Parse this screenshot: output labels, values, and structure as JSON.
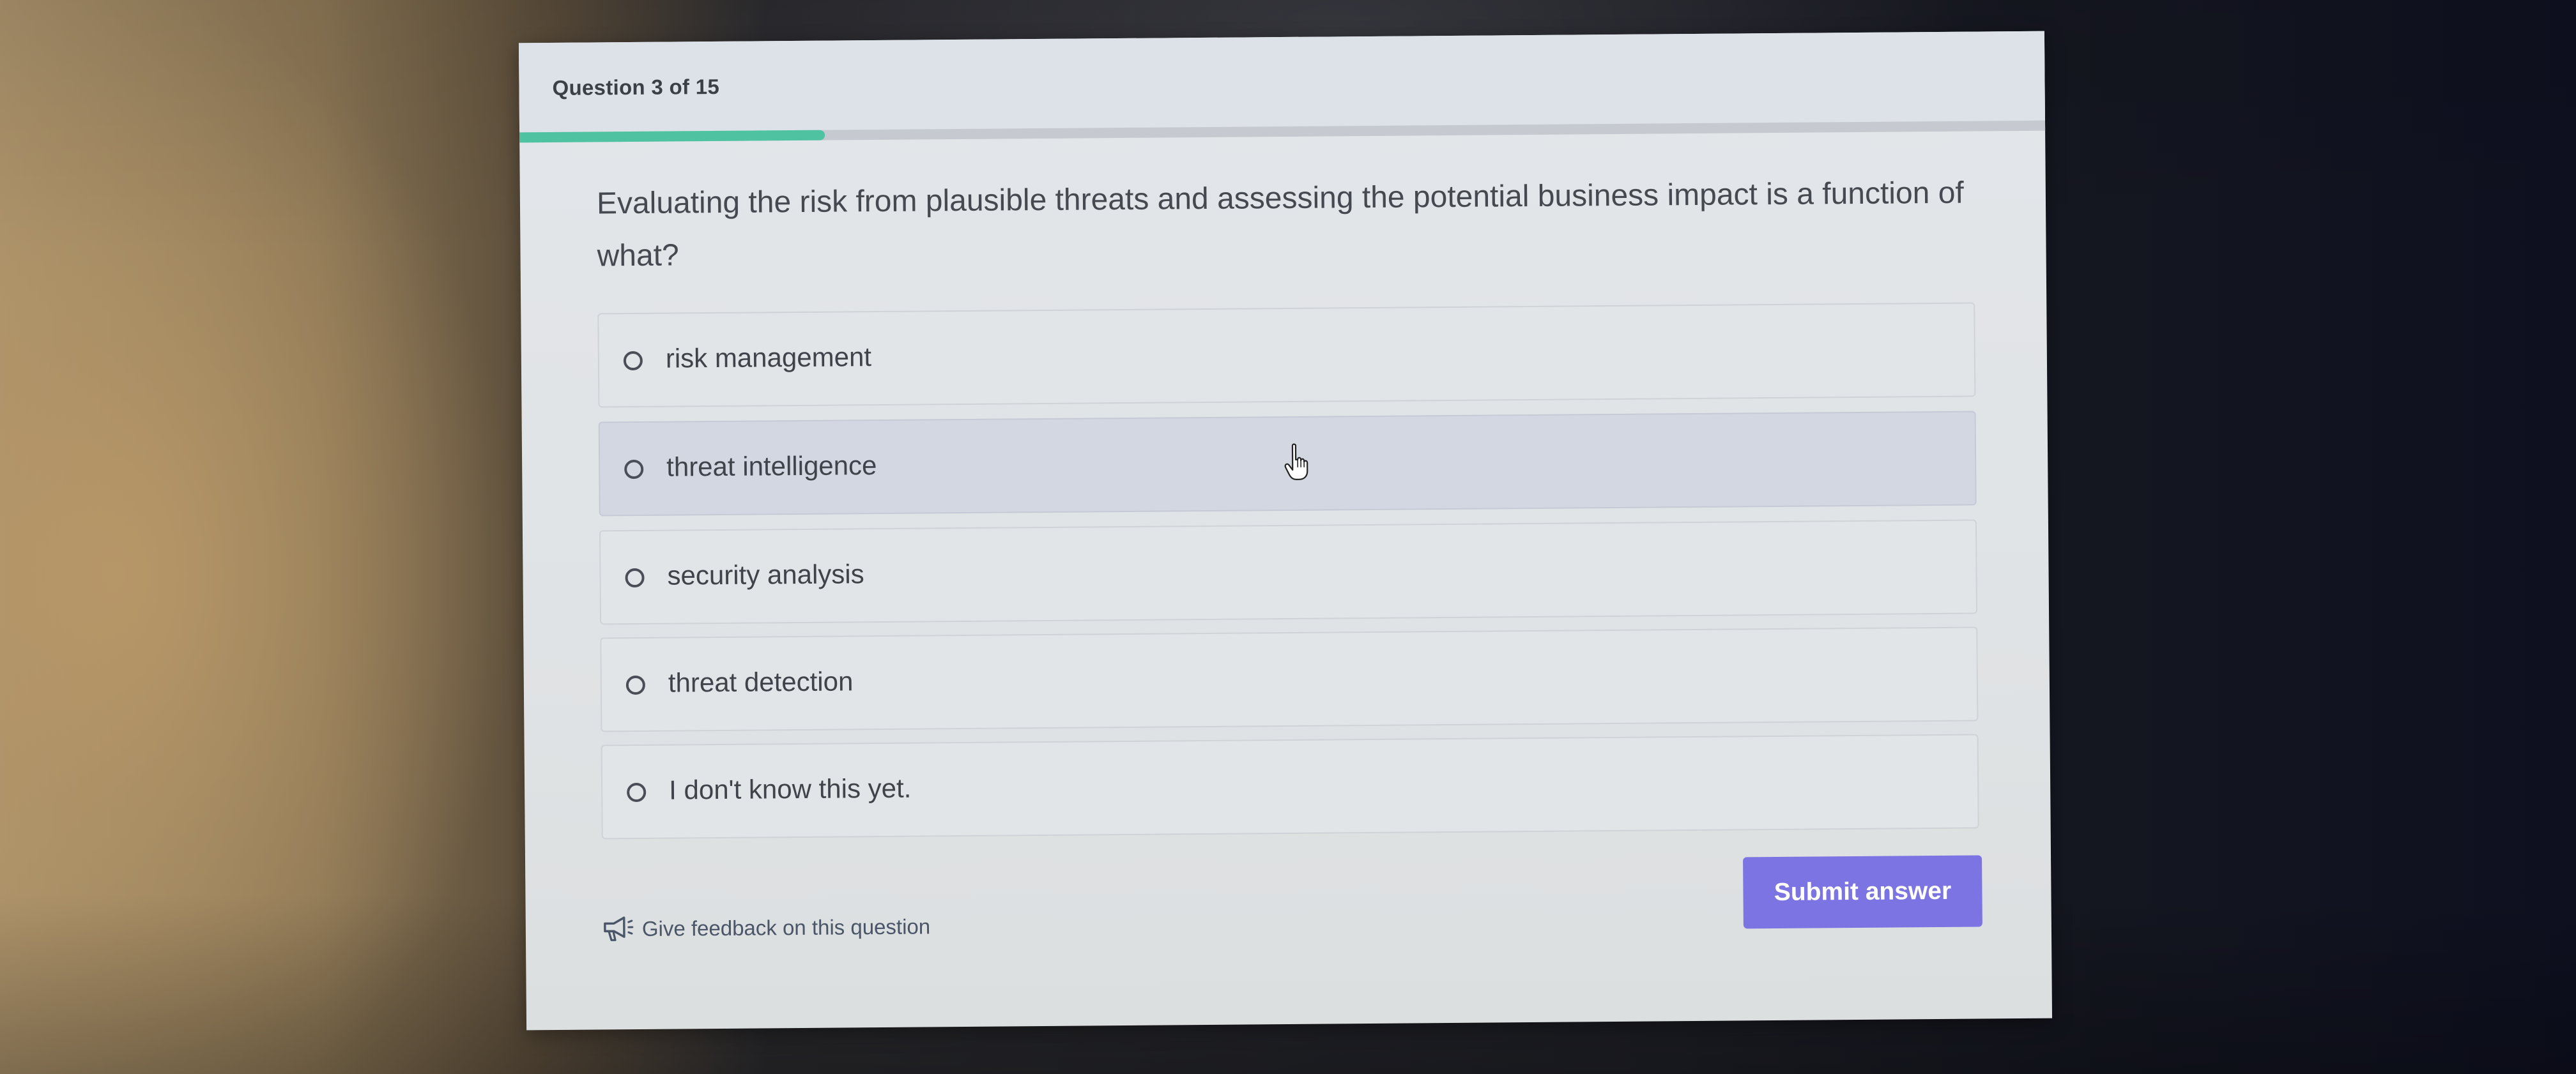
{
  "quiz": {
    "counter": "Question 3 of 15",
    "progress_fraction": 0.2,
    "question": "Evaluating the risk from plausible threats and assessing the potential business impact is a function of what?",
    "options": [
      {
        "label": "risk management"
      },
      {
        "label": "threat intelligence"
      },
      {
        "label": "security analysis"
      },
      {
        "label": "threat detection"
      },
      {
        "label": "I don't know this yet."
      }
    ],
    "hovered_option_index": 1
  },
  "footer": {
    "feedback_label": "Give feedback on this question",
    "submit_label": "Submit answer"
  },
  "icons": {
    "feedback": "megaphone-icon",
    "option_radio": "radio-button-icon",
    "cursor": "hand-pointer-icon"
  },
  "colors": {
    "progress": "#4fc3a1",
    "submit_button": "#7b74e2",
    "hovered_option": "#d2d7e2"
  }
}
